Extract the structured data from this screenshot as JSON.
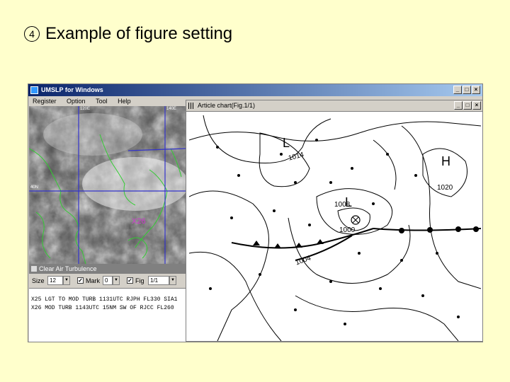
{
  "slide": {
    "number": "4",
    "title": "Example of figure setting"
  },
  "main_window": {
    "title": "UMSLP for Windows",
    "menu": [
      "Register",
      "Option",
      "Tool",
      "Help"
    ],
    "buttons": {
      "minimize": "_",
      "maximize": "□",
      "close": "×"
    }
  },
  "satellite": {
    "labels": {
      "lon_left": "120E",
      "lon_right": "140E",
      "lat": "40N",
      "marker": "X26"
    },
    "colors": {
      "coast": "#33cc33",
      "grid": "#3333cc",
      "marker": "#cc33cc"
    }
  },
  "cat_panel": {
    "title": "Clear Air Turbulence",
    "size_label": "Size",
    "size_value": "12",
    "mark_label": "Mark",
    "mark_value": "0",
    "fig_label": "Fig",
    "fig_value": "1/1",
    "lines": [
      "X25 LGT TO MOD TURB 1131UTC RJPH FL330 SIA1",
      "X26 MOD TURB 1143UTC 15NM SW OF RJCC FL260"
    ]
  },
  "chart_window": {
    "title": "Article chart(Fig.1/1)",
    "buttons": {
      "minimize": "_",
      "maximize": "□",
      "close": "×"
    },
    "isobar_labels": [
      "1014",
      "1008",
      "1000",
      "1004",
      "1020"
    ],
    "pressure_letters": [
      "L",
      "L",
      "H"
    ]
  }
}
